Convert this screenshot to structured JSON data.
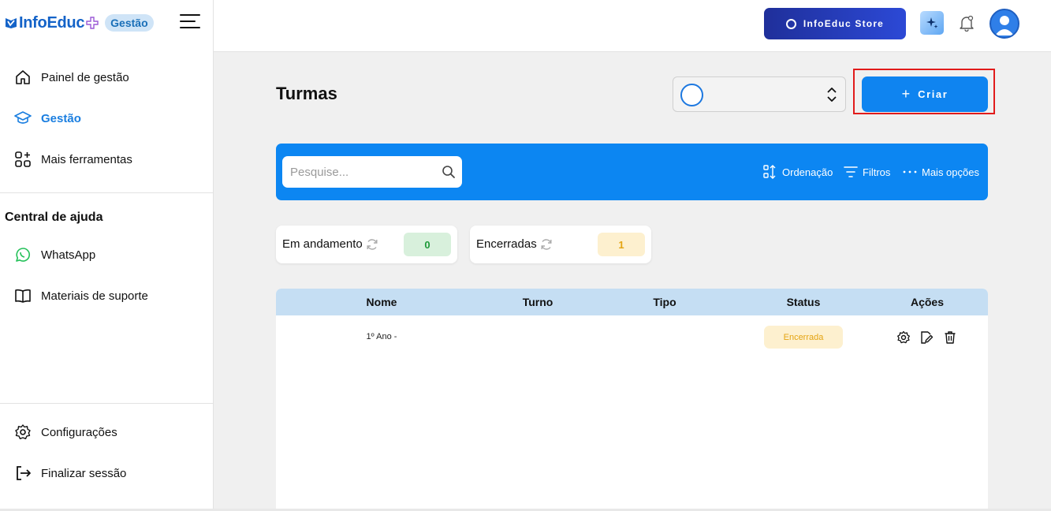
{
  "brand": {
    "name": "InfoEduc",
    "badge": "Gestão",
    "accent": "#1463c8"
  },
  "sidebar": {
    "items": [
      {
        "label": "Painel de gestão",
        "icon": "home-icon",
        "active": false
      },
      {
        "label": "Gestão",
        "icon": "graduation-cap-icon",
        "active": true
      },
      {
        "label": "Mais ferramentas",
        "icon": "grid-plus-icon",
        "active": false
      }
    ],
    "help_title": "Central de ajuda",
    "help_items": [
      {
        "label": "WhatsApp",
        "icon": "whatsapp-icon"
      },
      {
        "label": "Materiais de suporte",
        "icon": "book-icon"
      }
    ],
    "bottom_items": [
      {
        "label": "Configurações",
        "icon": "gear-icon"
      },
      {
        "label": "Finalizar sessão",
        "icon": "logout-icon"
      }
    ]
  },
  "header": {
    "store_label": "InfoEduc Store"
  },
  "main": {
    "title": "Turmas",
    "create_label": "Criar",
    "search": {
      "placeholder": "Pesquise..."
    },
    "toolbar": {
      "sort_label": "Ordenação",
      "filter_label": "Filtros",
      "more_label": "Mais opções"
    },
    "counters": [
      {
        "label": "Em andamento",
        "count": "0",
        "bg": "#d8f0dc",
        "fg": "#1f9a3a"
      },
      {
        "label": "Encerradas",
        "count": "1",
        "bg": "#fdf0cf",
        "fg": "#e4a412"
      }
    ],
    "table": {
      "columns": [
        "Nome",
        "Turno",
        "Tipo",
        "Status",
        "Ações"
      ],
      "rows": [
        {
          "nome": "1º Ano -",
          "turno": "",
          "tipo": "",
          "status": "Encerrada"
        }
      ]
    }
  }
}
